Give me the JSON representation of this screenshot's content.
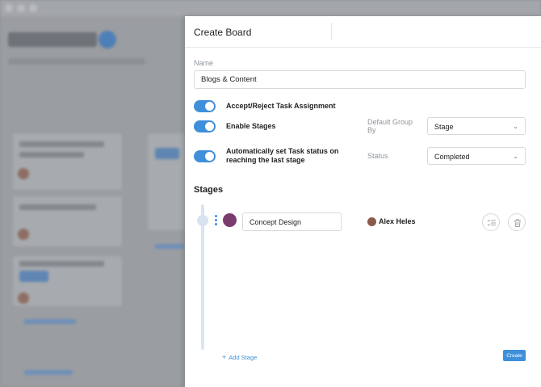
{
  "modal": {
    "title": "Create Board",
    "name_label": "Name",
    "name_value": "Blogs & Content",
    "toggles": [
      {
        "label": "Accept/Reject Task Assignment",
        "on": true
      },
      {
        "label": "Enable Stages",
        "on": true
      },
      {
        "label": "Automatically set Task status on reaching the last stage",
        "on": true
      }
    ],
    "default_group_label": "Default Group By",
    "default_group_value": "Stage",
    "status_label": "Status",
    "status_value": "Completed",
    "stages_heading": "Stages",
    "stages": [
      {
        "name": "Concept Design",
        "color": "#7a3b6e",
        "assignee": "Alex Heles"
      }
    ],
    "add_stage_label": "Add Stage",
    "create_label": "Create",
    "accent_color": "#3f8fdb"
  }
}
